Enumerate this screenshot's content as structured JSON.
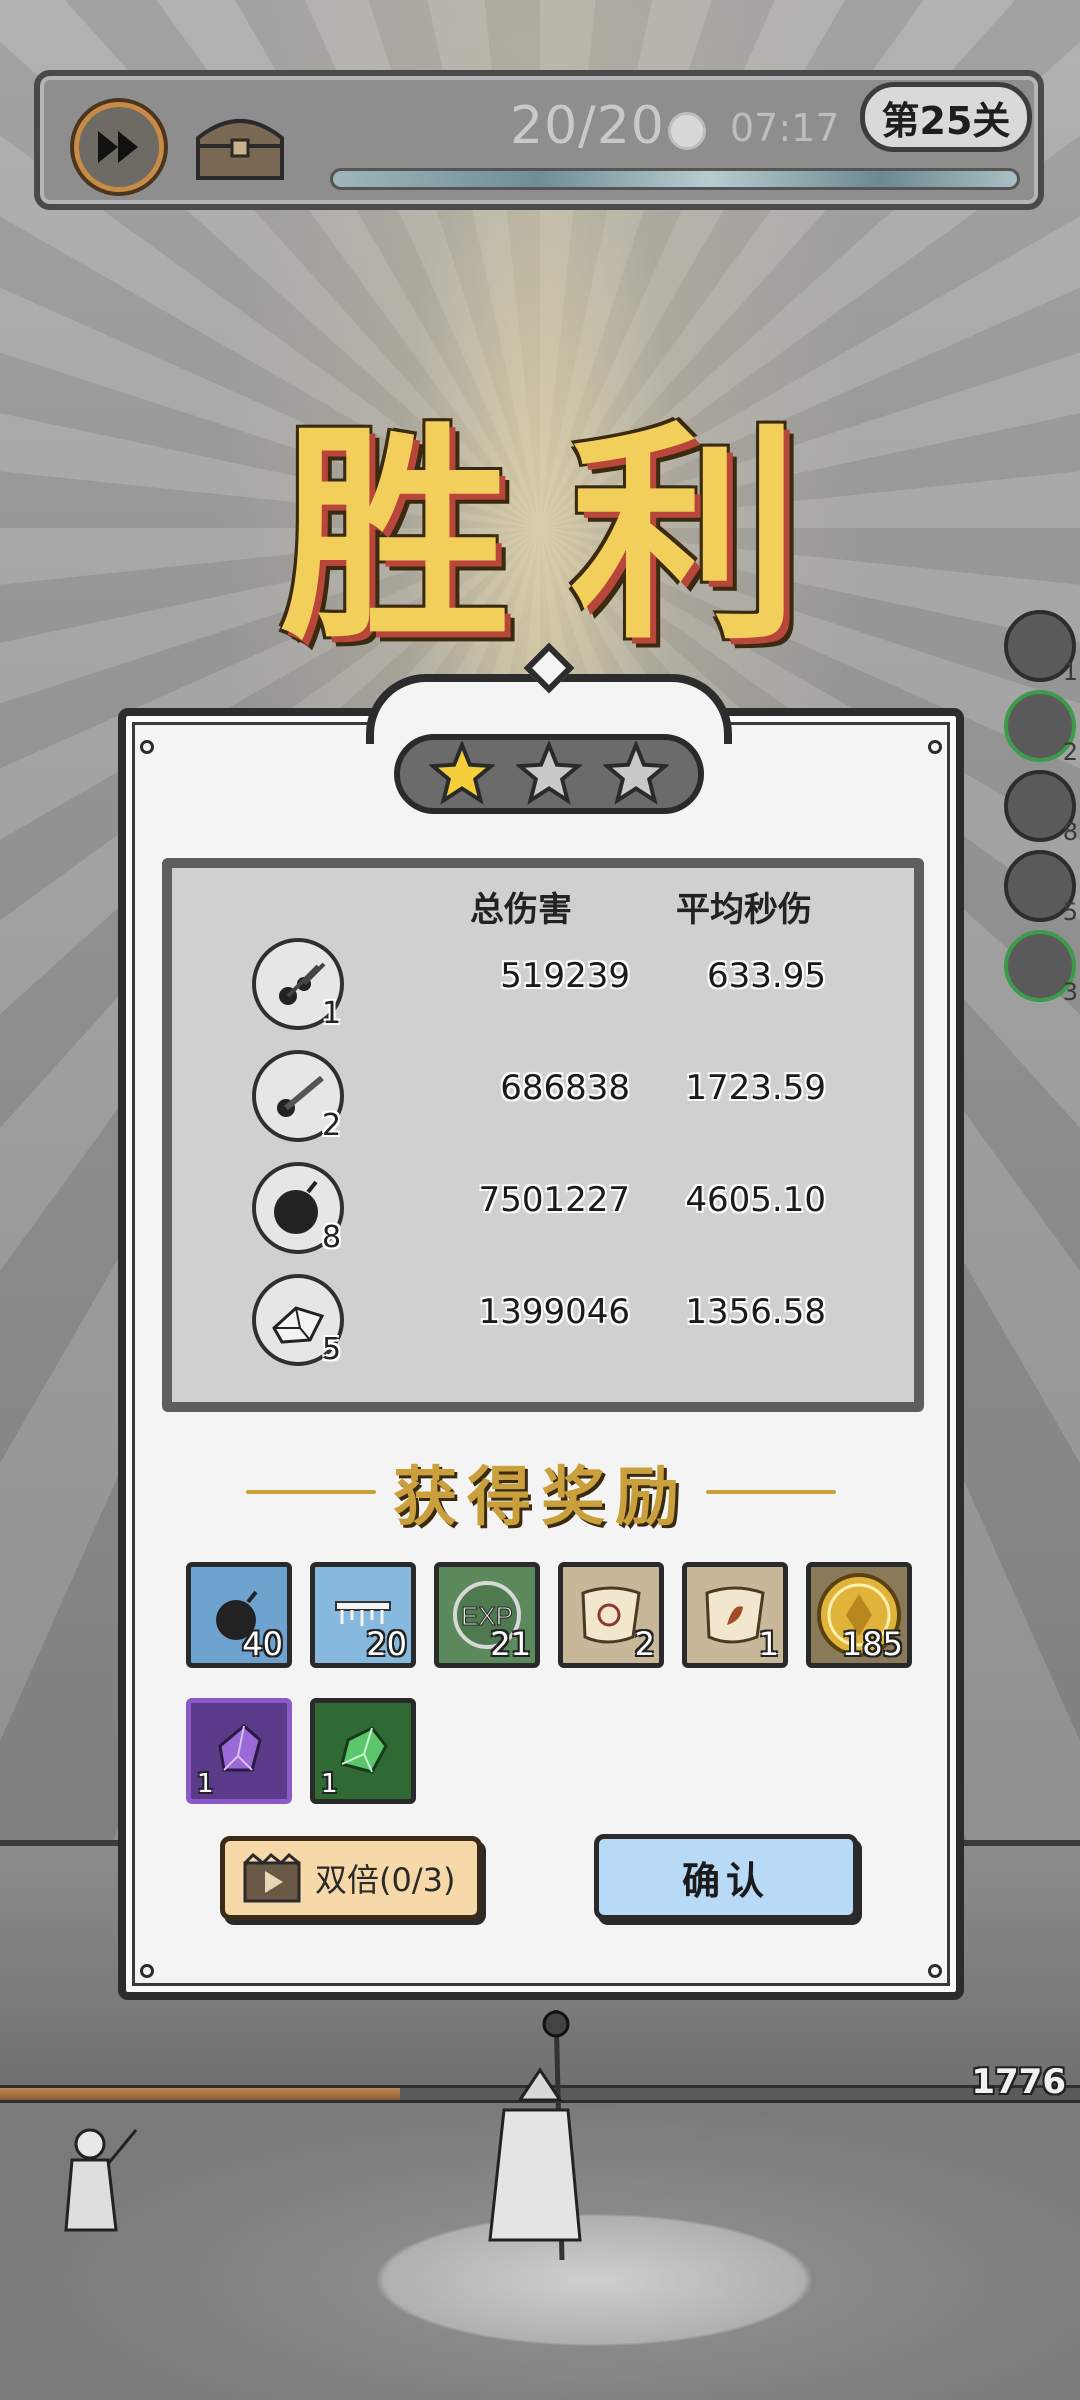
{
  "hud": {
    "wave": "20/20",
    "timer": "07:17",
    "level": "第25关",
    "speed_icon": "fast-forward-icon",
    "chest_icon": "treasure-chest-icon"
  },
  "victory_title": "胜利",
  "stars": {
    "earned": 1,
    "total": 3
  },
  "stats": {
    "header_total": "总伤害",
    "header_dps": "平均秒伤",
    "rows": [
      {
        "icon": "comet-skill-icon",
        "level": "1",
        "total": "519239",
        "dps": "633.95"
      },
      {
        "icon": "meteor-skill-icon",
        "level": "2",
        "total": "686838",
        "dps": "1723.59"
      },
      {
        "icon": "bomb-skill-icon",
        "level": "8",
        "total": "7501227",
        "dps": "4605.10"
      },
      {
        "icon": "crystal-skill-icon",
        "level": "5",
        "total": "1399046",
        "dps": "1356.58"
      }
    ]
  },
  "rewards": {
    "title": "获得奖励",
    "items": [
      {
        "icon": "bomb-card-icon",
        "count": "40",
        "color": "#6fa3cf"
      },
      {
        "icon": "ice-card-icon",
        "count": "20",
        "color": "#86b9dd"
      },
      {
        "icon": "exp-icon",
        "count": "21",
        "color": "#5c8a5c"
      },
      {
        "icon": "scroll-icon",
        "count": "2",
        "color": "#c9b79a"
      },
      {
        "icon": "scroll-icon",
        "count": "1",
        "color": "#c9b79a"
      },
      {
        "icon": "gold-coin-icon",
        "count": "185",
        "color": "#8a7a5a"
      },
      {
        "icon": "purple-crystal-icon",
        "count": "1",
        "color": "#5b3a8a"
      },
      {
        "icon": "green-crystal-icon",
        "count": "1",
        "color": "#2f6a35"
      }
    ]
  },
  "buttons": {
    "double_label": "双倍(0/3)",
    "confirm_label": "确认"
  },
  "side_skills": [
    {
      "level": "1"
    },
    {
      "level": "2"
    },
    {
      "level": "8"
    },
    {
      "level": "5"
    },
    {
      "level": "3"
    }
  ],
  "wall_hp": "1776"
}
